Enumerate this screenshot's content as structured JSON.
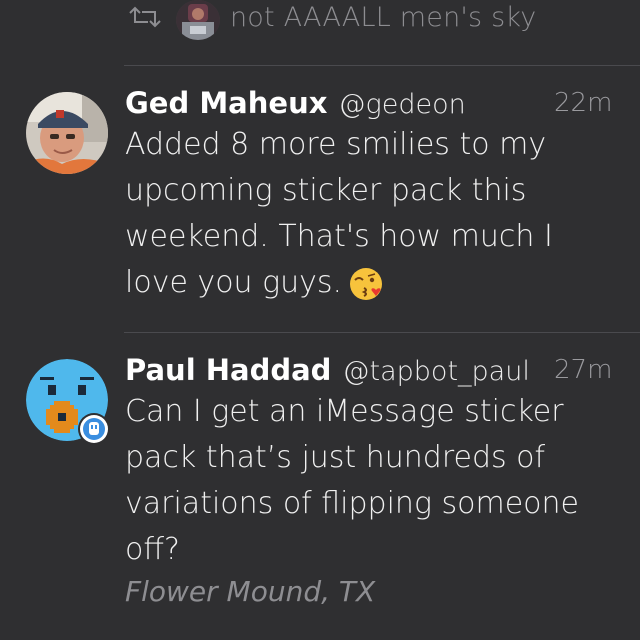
{
  "retweet_context": {
    "icon": "retweet-icon",
    "text": "not AAAALL men's sky"
  },
  "tweets": [
    {
      "name": "Ged Maheux",
      "handle": "@gedeon",
      "time": "22m",
      "text": "Added 8 more smilies to my upcoming sticker pack this weekend. That's how much I love you guys.",
      "emoji": "kissing-face-emoji"
    },
    {
      "name": "Paul Haddad",
      "handle": "@tapbot_paul",
      "time": "27m",
      "text": "Can I get an iMessage sticker pack that’s just hundreds of variations of flipping someone off?",
      "location": "Flower Mound, TX",
      "badge_icon": "tapbot-app-badge-icon"
    }
  ],
  "colors": {
    "background": "#2f2f31",
    "name": "#ffffff",
    "body": "#f0f0f0",
    "muted": "#8e8e92",
    "divider": "#4a4a4e"
  }
}
